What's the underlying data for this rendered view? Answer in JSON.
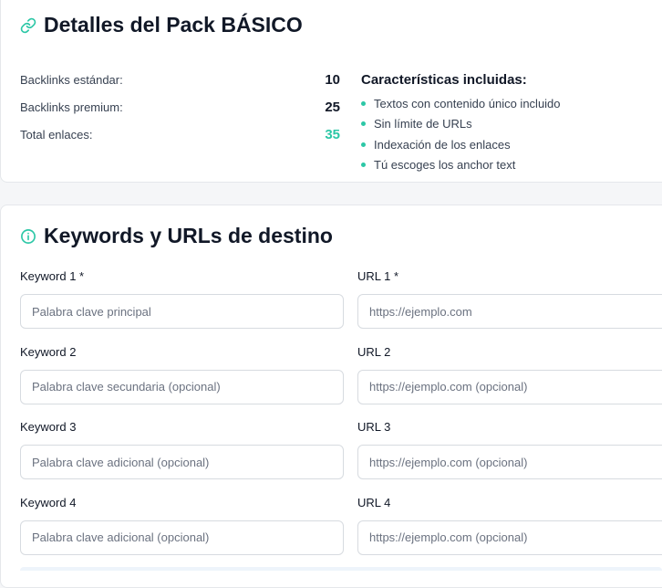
{
  "pack": {
    "title": "Detalles del Pack BÁSICO",
    "stats": [
      {
        "label": "Backlinks estándar:",
        "value": "10"
      },
      {
        "label": "Backlinks premium:",
        "value": "25"
      },
      {
        "label": "Total enlaces:",
        "value": "35"
      }
    ],
    "features_title": "Características incluidas:",
    "features": [
      "Textos con contenido único incluido",
      "Sin límite de URLs",
      "Indexación de los enlaces",
      "Tú escoges los anchor text"
    ]
  },
  "keywords": {
    "title": "Keywords y URLs de destino",
    "rows": [
      {
        "keyword_label": "Keyword 1 *",
        "keyword_placeholder": "Palabra clave principal",
        "url_label": "URL 1 *",
        "url_placeholder": "https://ejemplo.com"
      },
      {
        "keyword_label": "Keyword 2",
        "keyword_placeholder": "Palabra clave secundaria (opcional)",
        "url_label": "URL 2",
        "url_placeholder": "https://ejemplo.com (opcional)"
      },
      {
        "keyword_label": "Keyword 3",
        "keyword_placeholder": "Palabra clave adicional (opcional)",
        "url_label": "URL 3",
        "url_placeholder": "https://ejemplo.com (opcional)"
      },
      {
        "keyword_label": "Keyword 4",
        "keyword_placeholder": "Palabra clave adicional (opcional)",
        "url_label": "URL 4",
        "url_placeholder": "https://ejemplo.com (opcional)"
      }
    ]
  },
  "icons": {
    "pack": "link-icon",
    "keywords": "info-icon"
  },
  "colors": {
    "accent": "#2cc7a6",
    "text": "#111827",
    "muted": "#374151",
    "border": "#d7dbe0"
  }
}
